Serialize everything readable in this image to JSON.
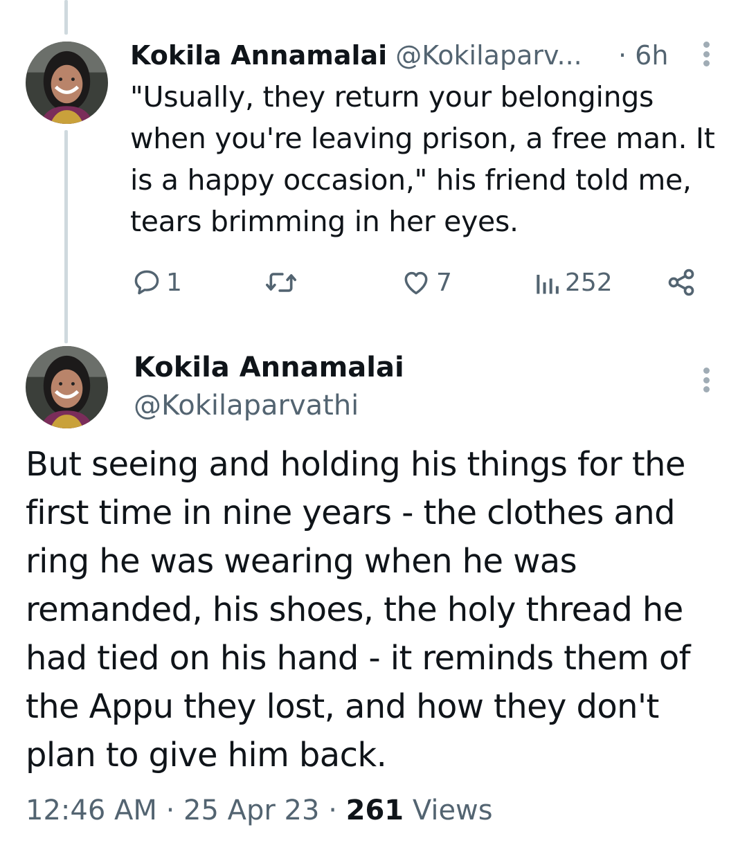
{
  "reply_tweet": {
    "author_name": "Kokila Annamalai",
    "author_handle": "@Kokilaparv...",
    "time_ago": "· 6h",
    "text": "\"Usually, they return your belongings when you're leaving prison, a free man. It is a happy occasion,\" his friend told me, tears brimming in her eyes.",
    "stats": {
      "replies": "1",
      "retweets": "",
      "likes": "7",
      "views": "252"
    }
  },
  "main_tweet": {
    "author_name": "Kokila Annamalai",
    "author_handle": "@Kokilaparvathi",
    "text": "But seeing and holding his things for the first time in nine years - the clothes and ring he was wearing when he was remanded, his shoes, the holy thread he had tied on his hand - it reminds them of the Appu they lost, and how they don't plan to give him back.",
    "time": "12:46 AM",
    "date": "25 Apr 23",
    "separator": "·",
    "views_count": "261",
    "views_label": "Views"
  },
  "icons": {
    "more": "more-vertical-icon",
    "reply": "reply-bubble-icon",
    "retweet": "retweet-icon",
    "like": "heart-icon",
    "views": "views-bar-chart-icon",
    "share": "share-icon"
  },
  "colors": {
    "text_primary": "#0f1419",
    "text_secondary": "#536471",
    "thread_line": "#cfd9de"
  }
}
